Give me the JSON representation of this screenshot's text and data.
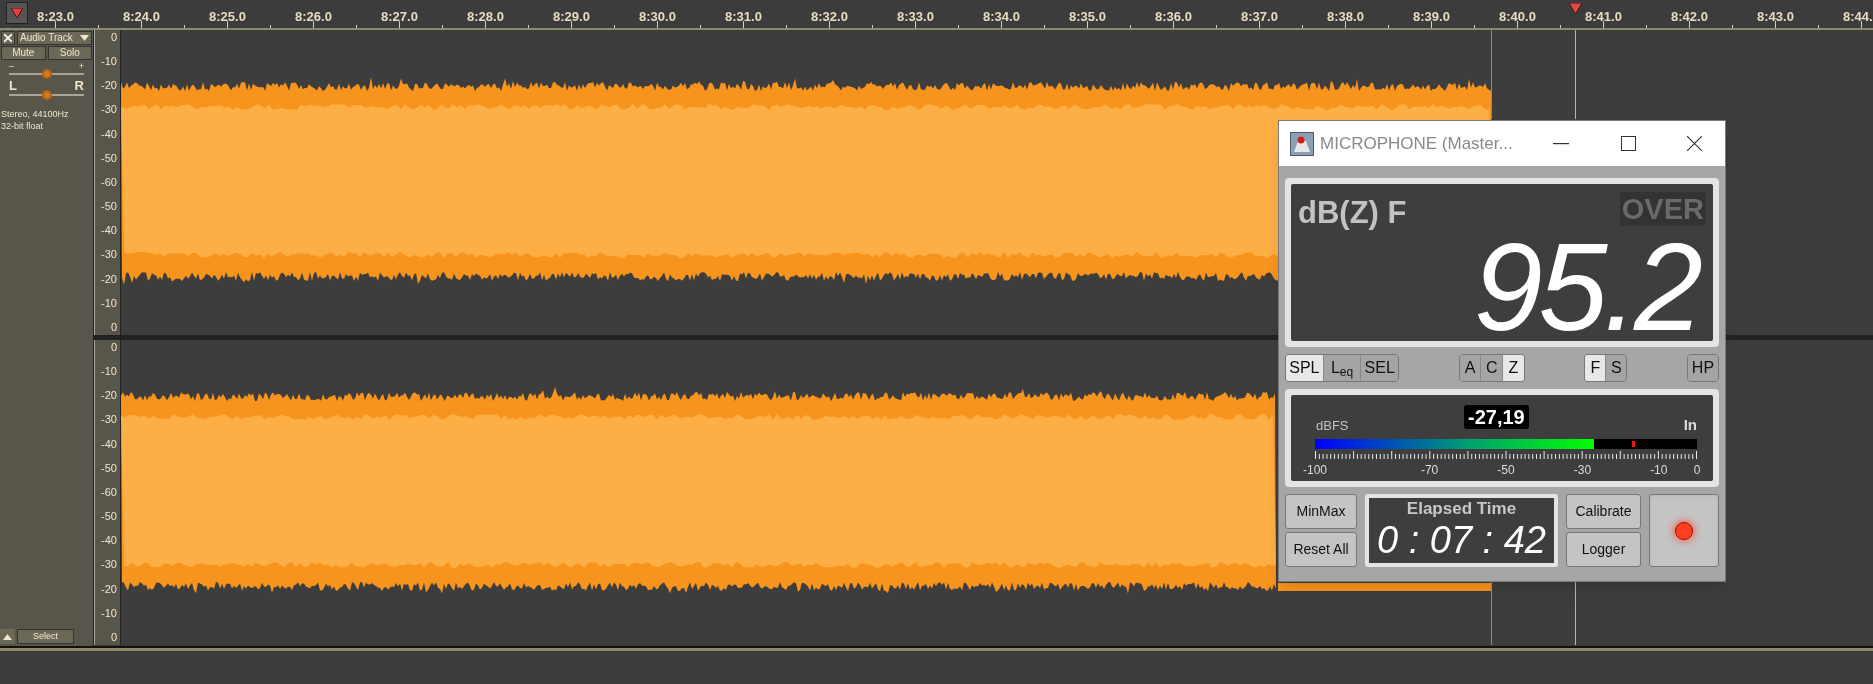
{
  "timeline": {
    "labels": [
      "8:23.0",
      "8:24.0",
      "8:25.0",
      "8:26.0",
      "8:27.0",
      "8:28.0",
      "8:29.0",
      "8:30.0",
      "8:31.0",
      "8:32.0",
      "8:33.0",
      "8:34.0",
      "8:35.0",
      "8:36.0",
      "8:37.0",
      "8:38.0",
      "8:39.0",
      "8:40.0",
      "8:41.0",
      "8:42.0",
      "8:43.0",
      "8:44."
    ]
  },
  "track": {
    "name": "Audio Track",
    "mute": "Mute",
    "solo": "Solo",
    "gain": {
      "minus": "–",
      "plus": "+",
      "level": 0.5
    },
    "pan": {
      "left": "L",
      "right": "R",
      "level": 0.5
    },
    "info": [
      "Stereo, 44100Hz",
      "32-bit float"
    ],
    "select": "Select"
  },
  "channels": [
    {
      "scale": [
        "0",
        "-10",
        "-20",
        "-30",
        "-40",
        "-50",
        "-60",
        "-50",
        "-40",
        "-30",
        "-20",
        "-10",
        "0"
      ]
    },
    {
      "scale": [
        "0",
        "-10",
        "-20",
        "-30",
        "-40",
        "-50",
        "-60",
        "-50",
        "-40",
        "-30",
        "-20",
        "-10",
        "0"
      ]
    }
  ],
  "meter": {
    "title": "MICROPHONE (Master...",
    "mode": "dB(Z) F",
    "over": {
      "label": "OVER",
      "on": false
    },
    "reading": "95.2",
    "button_groups": [
      [
        {
          "label": "SPL",
          "selected": true
        },
        {
          "label": "L$_{eq}$",
          "selected": false
        },
        {
          "label": "SEL",
          "selected": false
        }
      ],
      [
        {
          "label": "A",
          "selected": false
        },
        {
          "label": "C",
          "selected": false
        },
        {
          "label": "Z",
          "selected": true
        }
      ],
      [
        {
          "label": "F",
          "selected": true
        },
        {
          "label": "S",
          "selected": false
        }
      ],
      [
        {
          "label": "HP",
          "selected": false
        }
      ]
    ],
    "level_meter": {
      "unit": "dBFS",
      "value": "-27,19",
      "input": "In",
      "level": 0.73,
      "peak": {
        "level": 0.83
      },
      "scale": [
        "-100",
        "-70",
        "-50",
        "-30",
        "-10",
        "0"
      ]
    },
    "buttons_left": [
      "MinMax",
      "Reset All"
    ],
    "elapsed": {
      "label": "Elapsed Time",
      "value": "0 : 07 : 42"
    },
    "buttons_right": [
      "Calibrate",
      "Logger"
    ],
    "recording": true
  }
}
